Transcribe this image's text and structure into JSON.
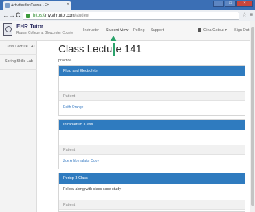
{
  "browser": {
    "tab_title": "Activities for Course - EH",
    "url_secure": "https://",
    "url_domain": "my.ehrtutor.com",
    "url_path": "/student",
    "back_icon": "back-arrow-icon",
    "forward_icon": "forward-arrow-icon",
    "reload_icon": "reload-icon",
    "close_glyph": "×",
    "minimize_glyph": "–",
    "maximize_glyph": "□",
    "window_close_glyph": "×",
    "back_glyph": "←",
    "forward_glyph": "→",
    "reload_glyph": "C",
    "star_glyph": "☆",
    "menu_glyph": "≡"
  },
  "header": {
    "title": "EHR Tutor",
    "subtitle": "Rowan College at Gloucester County",
    "nav": {
      "instructor": "Instructor",
      "student_view": "Student View",
      "polling": "Polling",
      "support": "Support",
      "user": "Gina Gatout",
      "user_caret": "▾",
      "sign_out": "Sign Out"
    }
  },
  "sidebar": {
    "items": [
      {
        "label": "Class Lecture 141"
      },
      {
        "label": "Spring Skills Lab"
      }
    ]
  },
  "main": {
    "title": "Class Lecture 141",
    "subtitle": "practice",
    "cards": [
      {
        "title": "Fluid and Electrolyte",
        "description": "",
        "patient_label": "Patient",
        "patient_name": "Edith Orange"
      },
      {
        "title": "Intrapartum Class",
        "description": "",
        "patient_label": "Patient",
        "patient_name": "Zoe A Normalator Copy"
      },
      {
        "title": "Periop 3 Class",
        "description": "Follow along with class case study",
        "patient_label": "Patient",
        "patient_name": ""
      }
    ]
  },
  "colors": {
    "card_header": "#2f7bbf",
    "link": "#3b7dc4",
    "accent_marker": "#2aa36b"
  }
}
